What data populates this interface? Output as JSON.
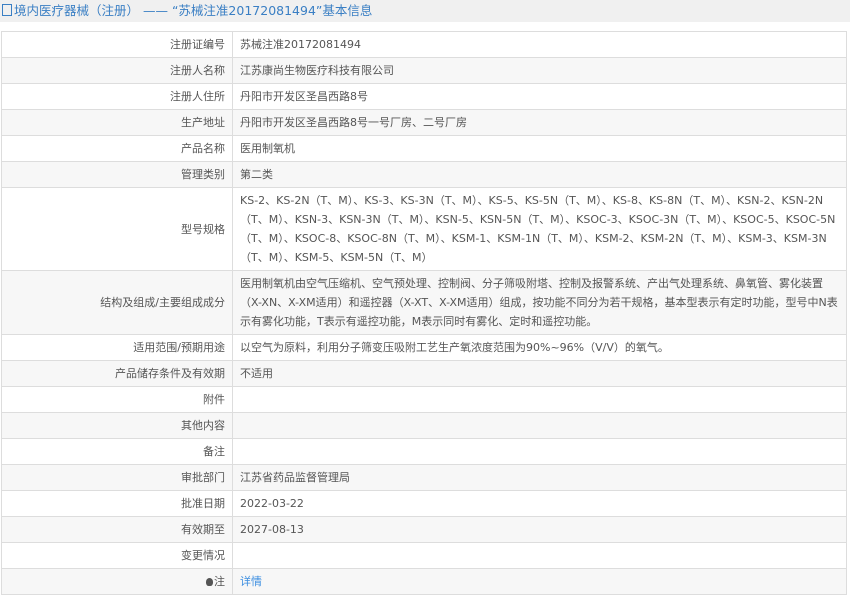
{
  "title": "境内医疗器械（注册） —— “苏械注准20172081494”基本信息",
  "rows": [
    {
      "label": "注册证编号",
      "value": "苏械注准20172081494"
    },
    {
      "label": "注册人名称",
      "value": "江苏康尚生物医疗科技有限公司"
    },
    {
      "label": "注册人住所",
      "value": "丹阳市开发区圣昌西路8号"
    },
    {
      "label": "生产地址",
      "value": "丹阳市开发区圣昌西路8号一号厂房、二号厂房"
    },
    {
      "label": "产品名称",
      "value": "医用制氧机"
    },
    {
      "label": "管理类别",
      "value": "第二类"
    },
    {
      "label": "型号规格",
      "value": "KS-2、KS-2N（T、M）、KS-3、KS-3N（T、M）、KS-5、KS-5N（T、M）、KS-8、KS-8N（T、M）、KSN-2、KSN-2N（T、M）、KSN-3、KSN-3N（T、M）、KSN-5、KSN-5N（T、M）、KSOC-3、KSOC-3N（T、M）、KSOC-5、KSOC-5N（T、M）、KSOC-8、KSOC-8N（T、M）、KSM-1、KSM-1N（T、M）、KSM-2、KSM-2N（T、M）、KSM-3、KSM-3N（T、M）、KSM-5、KSM-5N（T、M）"
    },
    {
      "label": "结构及组成/主要组成成分",
      "value": "医用制氧机由空气压缩机、空气预处理、控制阀、分子筛吸附塔、控制及报警系统、产出气处理系统、鼻氧管、雾化装置（X-XN、X-XM适用）和遥控器（X-XT、X-XM适用）组成，按功能不同分为若干规格，基本型表示有定时功能，型号中N表示有雾化功能，T表示有遥控功能，M表示同时有雾化、定时和遥控功能。"
    },
    {
      "label": "适用范围/预期用途",
      "value": "以空气为原料，利用分子筛变压吸附工艺生产氧浓度范围为90%~96%（V/V）的氧气。"
    },
    {
      "label": "产品储存条件及有效期",
      "value": "不适用"
    },
    {
      "label": "附件",
      "value": ""
    },
    {
      "label": "其他内容",
      "value": ""
    },
    {
      "label": "备注",
      "value": ""
    },
    {
      "label": "审批部门",
      "value": "江苏省药品监督管理局"
    },
    {
      "label": "批准日期",
      "value": "2022-03-22"
    },
    {
      "label": "有效期至",
      "value": "2027-08-13"
    },
    {
      "label": "变更情况",
      "value": ""
    }
  ],
  "note": {
    "label": "注",
    "link": "详情"
  }
}
